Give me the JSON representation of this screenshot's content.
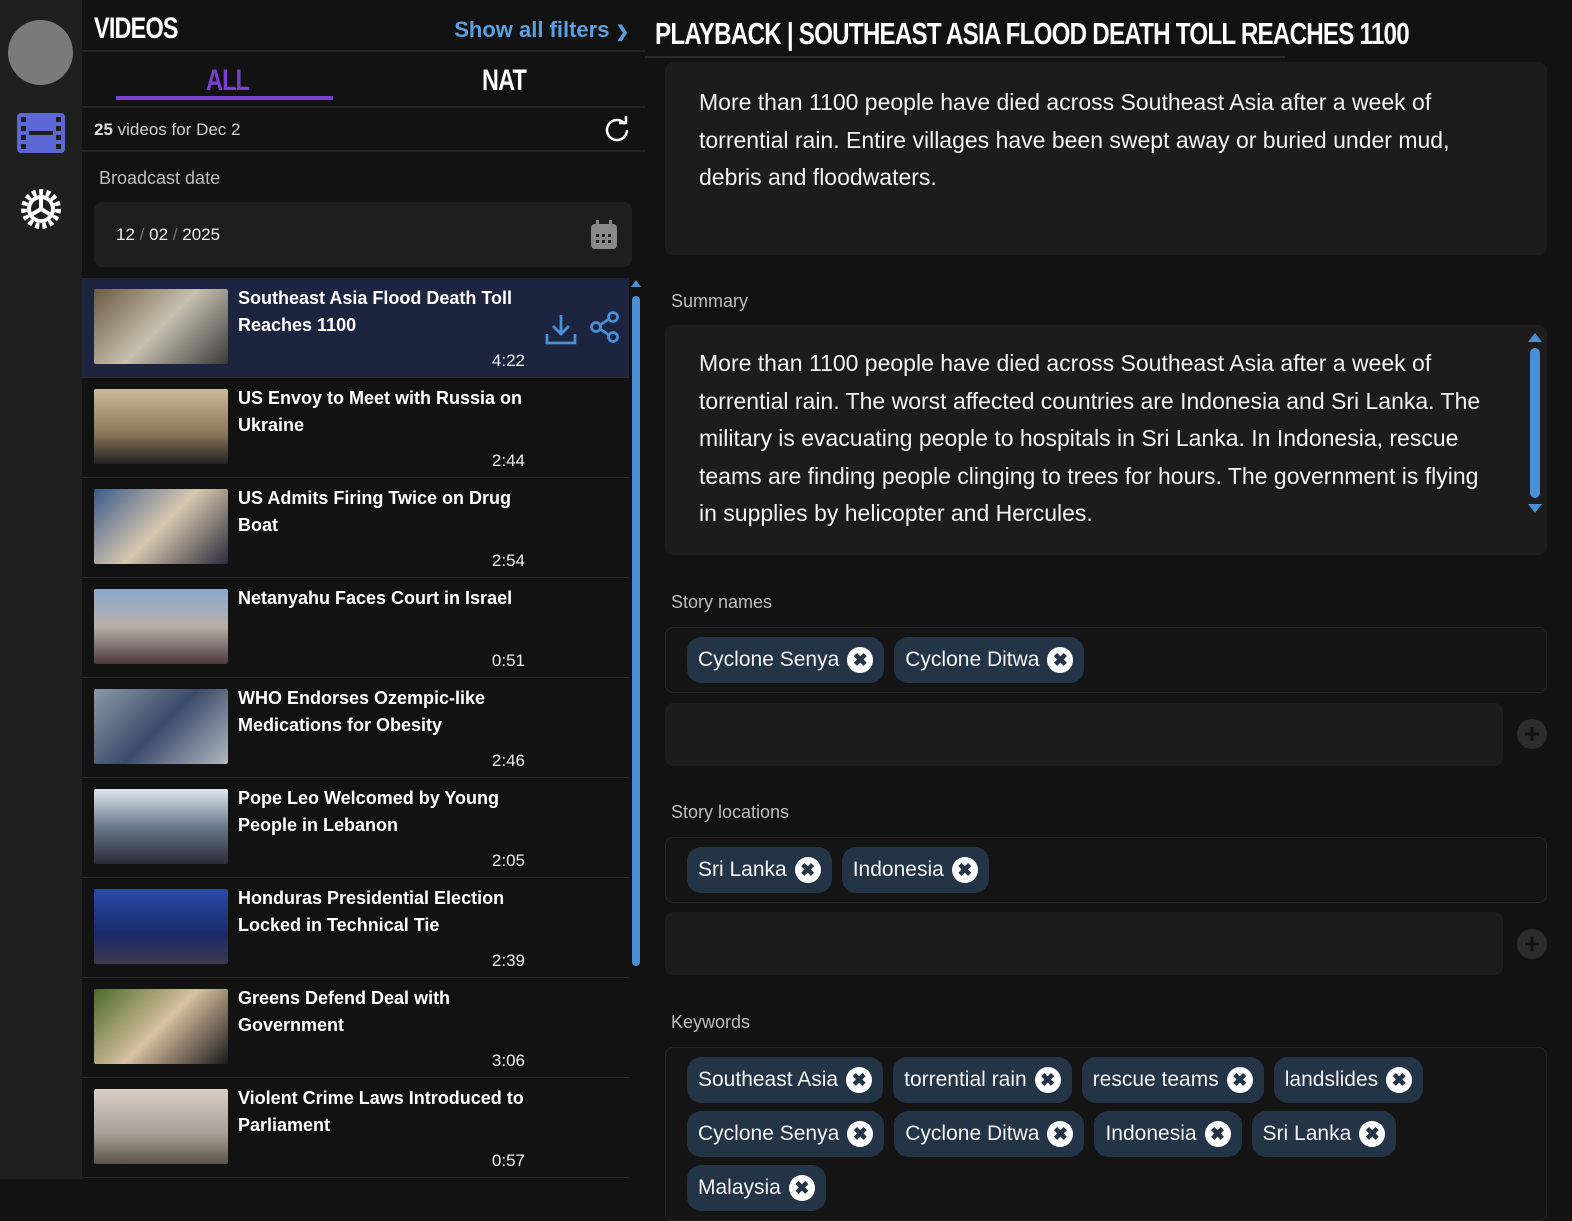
{
  "nav": {
    "icons": [
      "avatar",
      "film-icon",
      "settings-icon"
    ]
  },
  "videos": {
    "title": "Videos",
    "show_filters": "Show all filters",
    "tabs": [
      "ALL",
      "NAT"
    ],
    "count": "25",
    "count_suffix": " videos for Dec 2",
    "broadcast_label": "Broadcast date",
    "date": {
      "month": "12",
      "day": "02",
      "year": "2025",
      "sep": "/"
    },
    "items": [
      {
        "title": "Southeast Asia Flood Death Toll Reaches 1100",
        "duration": "4:22"
      },
      {
        "title": "US Envoy to Meet with Russia on Ukraine",
        "duration": "2:44"
      },
      {
        "title": "US Admits Firing Twice on Drug Boat",
        "duration": "2:54"
      },
      {
        "title": "Netanyahu Faces Court in Israel",
        "duration": "0:51"
      },
      {
        "title": "WHO Endorses Ozempic-like Medications for Obesity",
        "duration": "2:46"
      },
      {
        "title": "Pope Leo Welcomed by Young People in Lebanon",
        "duration": "2:05"
      },
      {
        "title": "Honduras Presidential Election Locked in Technical Tie",
        "duration": "2:39"
      },
      {
        "title": "Greens Defend Deal with Government",
        "duration": "3:06"
      },
      {
        "title": "Violent Crime Laws Introduced to Parliament",
        "duration": "0:57"
      }
    ]
  },
  "playback": {
    "prefix": "Playback",
    "sep": "|",
    "title": "Southeast Asia Flood Death Toll Reaches 1100",
    "description": "More than 1100 people have died across Southeast Asia after a week of torrential rain. Entire villages have been swept away or buried under mud, debris and floodwaters.",
    "summary_label": "Summary",
    "summary": "More than 1100 people have died across Southeast Asia after a week of torrential rain. The worst affected countries are Indonesia and Sri Lanka. The military is evacuating people to hospitals in Sri Lanka. In Indonesia, rescue teams are finding people clinging to trees for hours. The government is flying in supplies by helicopter and Hercules.",
    "story_names_label": "Story names",
    "story_names": [
      "Cyclone Senya",
      "Cyclone Ditwa"
    ],
    "story_locations_label": "Story locations",
    "story_locations": [
      "Sri Lanka",
      "Indonesia"
    ],
    "keywords_label": "Keywords",
    "keywords": [
      "Southeast Asia",
      "torrential rain",
      "rescue teams",
      "landslides",
      "Cyclone Senya",
      "Cyclone Ditwa",
      "Indonesia",
      "Sri Lanka",
      "Malaysia"
    ]
  },
  "colors": {
    "accent": "#7b3fd0",
    "link": "#5aa0e0",
    "chip": "#243447",
    "selected": "#1c2440"
  }
}
